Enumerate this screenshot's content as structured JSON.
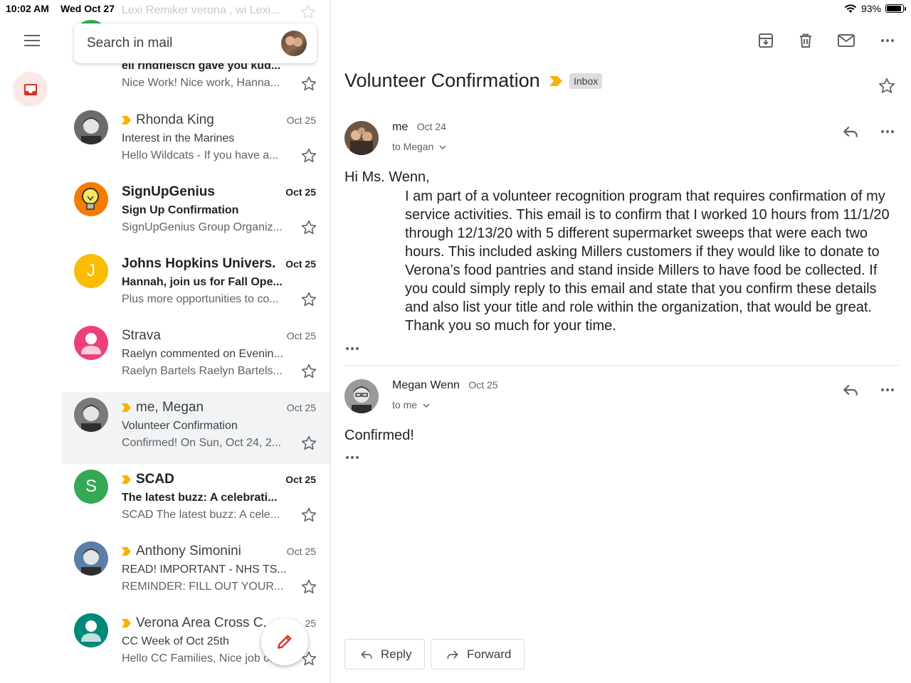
{
  "status": {
    "time": "10:02 AM",
    "date": "Wed Oct 27",
    "battery": "93%",
    "battery_level": 0.93
  },
  "search": {
    "placeholder": "Search in mail"
  },
  "ghost_row": {
    "text": "Lexi Remiker verona , wi Lexi..."
  },
  "emails": [
    {
      "sender": "",
      "subject": "eli rindfleisch gave you kud...",
      "snippet": "Nice Work! Nice work, Hanna...",
      "date": "",
      "unread": true,
      "important": false,
      "avatar": {
        "type": "letter",
        "letter": "",
        "color": "#34a853"
      }
    },
    {
      "sender": "Rhonda King",
      "subject": "Interest in the Marines",
      "snippet": "Hello Wildcats - If you have a...",
      "date": "Oct 25",
      "unread": false,
      "important": true,
      "avatar": {
        "type": "photo",
        "color": "#6b6b6b"
      }
    },
    {
      "sender": "SignUpGenius",
      "subject": "Sign Up Confirmation",
      "snippet": "SignUpGenius Group Organiz...",
      "date": "Oct 25",
      "unread": true,
      "important": false,
      "avatar": {
        "type": "bulb",
        "color": "#f57c00"
      }
    },
    {
      "sender": "Johns Hopkins Univers.",
      "subject": "Hannah, join us for Fall Ope...",
      "snippet": "Plus more opportunities to co...",
      "date": "Oct 25",
      "unread": true,
      "important": false,
      "avatar": {
        "type": "letter",
        "letter": "J",
        "color": "#fbbc04"
      }
    },
    {
      "sender": "Strava",
      "subject": "Raelyn commented on Evenin...",
      "snippet": "Raelyn Bartels Raelyn Bartels...",
      "date": "Oct 25",
      "unread": false,
      "important": false,
      "avatar": {
        "type": "person",
        "color": "#ec407a"
      }
    },
    {
      "sender": "me, Megan",
      "subject": "Volunteer Confirmation",
      "snippet": "Confirmed! On Sun, Oct 24, 2...",
      "date": "Oct 25",
      "unread": false,
      "important": true,
      "selected": true,
      "avatar": {
        "type": "photo",
        "color": "#7a7a7a"
      }
    },
    {
      "sender": "SCAD",
      "subject": "The latest buzz: A celebrati...",
      "snippet": "SCAD The latest buzz: A cele...",
      "date": "Oct 25",
      "unread": true,
      "important": true,
      "avatar": {
        "type": "letter",
        "letter": "S",
        "color": "#34a853"
      }
    },
    {
      "sender": "Anthony Simonini",
      "subject": "READ! IMPORTANT - NHS TS...",
      "snippet": "REMINDER: FILL OUT YOUR...",
      "date": "Oct 25",
      "unread": false,
      "important": true,
      "avatar": {
        "type": "photo",
        "color": "#5b7fa6"
      }
    },
    {
      "sender": "Verona Area Cross C.",
      "subject": "CC Week of Oct 25th",
      "snippet": "Hello CC Families, Nice job o...",
      "date": "25",
      "unread": false,
      "important": true,
      "avatar": {
        "type": "person",
        "color": "#00897b"
      }
    }
  ],
  "thread": {
    "title": "Volunteer Confirmation",
    "label": "Inbox",
    "messages": [
      {
        "from": "me",
        "date": "Oct 24",
        "to": "to Megan",
        "greeting": "Hi Ms. Wenn,",
        "body": "I am part of a volunteer recognition program that requires confirmation of my service activities. This email is to confirm that I worked 10 hours from 11/1/20 through 12/13/20 with 5 different supermarket sweeps that were each two hours. This included asking Millers customers if they would like to donate to Verona’s food pantries  and stand inside Millers to have food be collected. If you could simply reply to this email and state that you confirm these details and also list your title and role within the organization, that would be great. Thank you so much for your time."
      },
      {
        "from": "Megan Wenn",
        "date": "Oct 25",
        "to": "to me",
        "body": "Confirmed!"
      }
    ]
  },
  "actions": {
    "reply": "Reply",
    "forward": "Forward"
  },
  "colors": {
    "accent_red": "#d93025",
    "important_yellow": "#f4b400",
    "selected_bg": "#f1f3f4"
  }
}
